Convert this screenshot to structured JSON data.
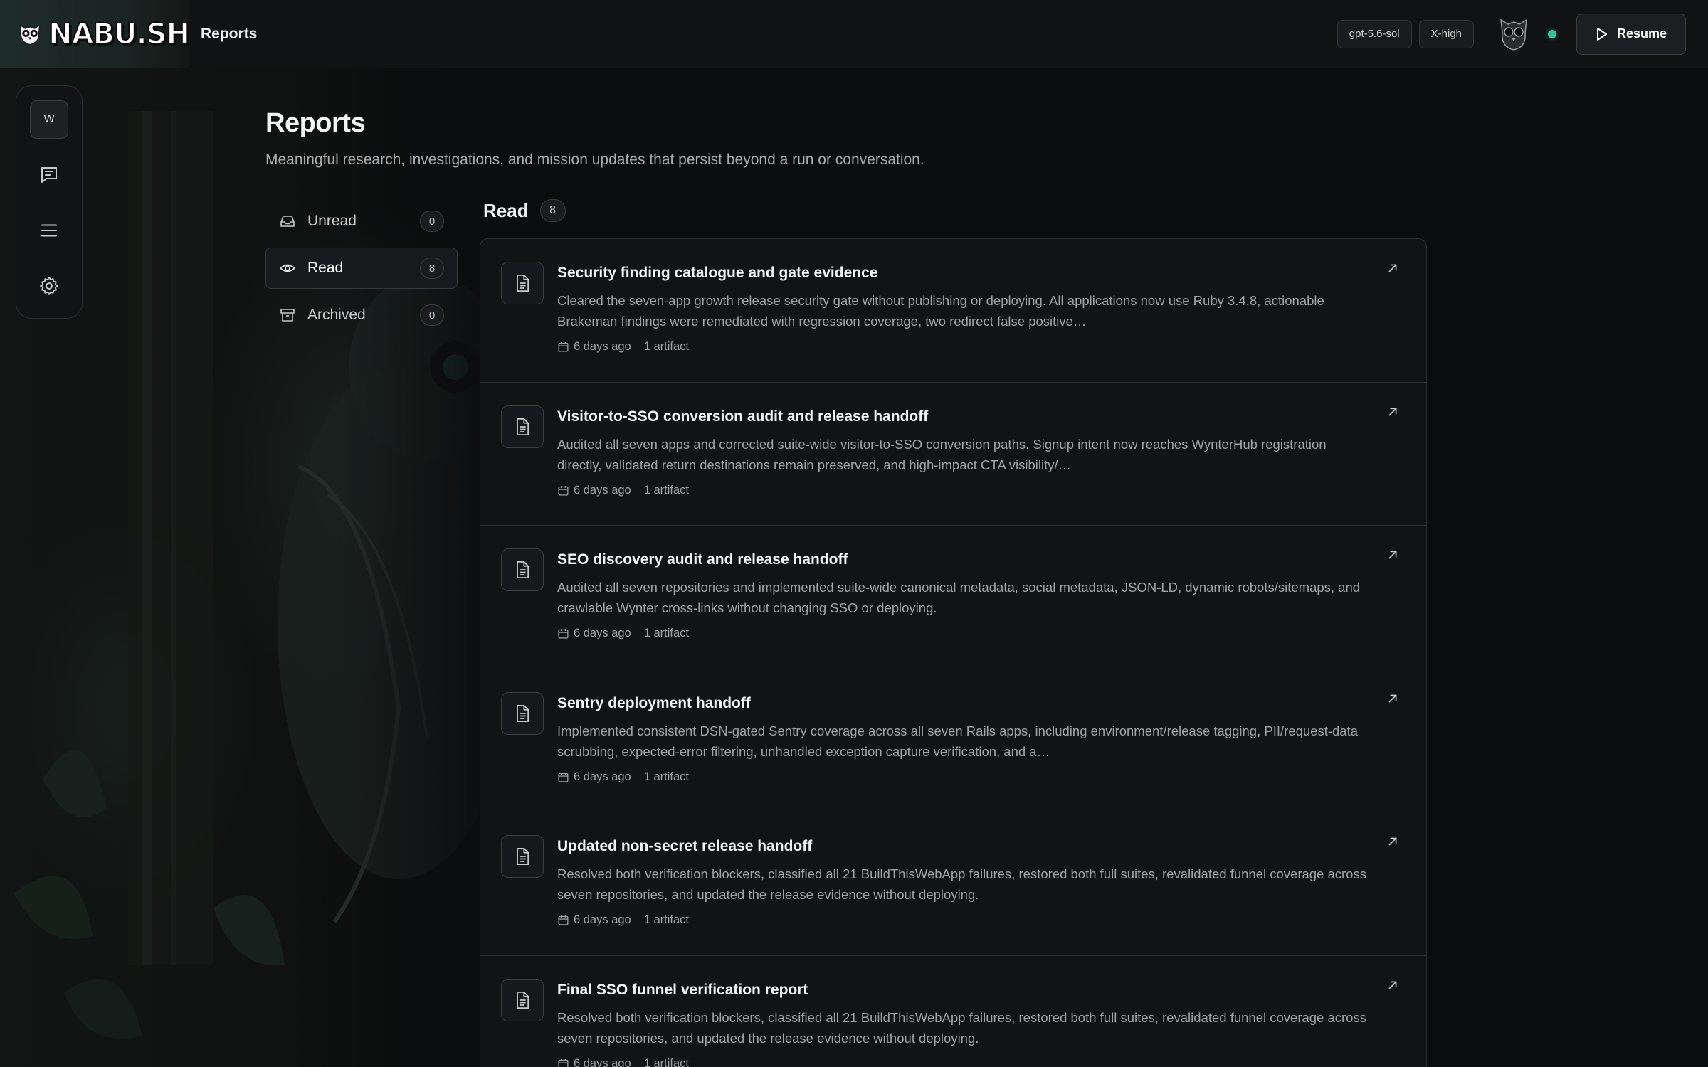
{
  "app": {
    "brand": "NABU.SH",
    "header_title": "Reports",
    "model_chip": "gpt-5.6-sol",
    "effort_chip": "X-high",
    "resume_label": "Resume",
    "status_color": "#34c39a"
  },
  "rail": {
    "workspace_initial": "W",
    "items": [
      "chat-icon",
      "list-icon",
      "gear-icon"
    ]
  },
  "page": {
    "title": "Reports",
    "subtitle": "Meaningful research, investigations, and mission updates that persist beyond a run or conversation."
  },
  "filters": [
    {
      "label": "Unread",
      "count": "0",
      "icon": "inbox-icon",
      "active": false
    },
    {
      "label": "Read",
      "count": "8",
      "icon": "eye-icon",
      "active": true
    },
    {
      "label": "Archived",
      "count": "0",
      "icon": "archive-icon",
      "active": false
    }
  ],
  "section": {
    "title": "Read",
    "count": "8"
  },
  "reports": [
    {
      "title": "Security finding catalogue and gate evidence",
      "description": "Cleared the seven-app growth release security gate without publishing or deploying. All applications now use Ruby 3.4.8, actionable Brakeman findings were remediated with regression coverage, two redirect false positive…",
      "time": "6 days ago",
      "artifacts": "1 artifact"
    },
    {
      "title": "Visitor-to-SSO conversion audit and release handoff",
      "description": "Audited all seven apps and corrected suite-wide visitor-to-SSO conversion paths. Signup intent now reaches WynterHub registration directly, validated return destinations remain preserved, and high-impact CTA visibility/…",
      "time": "6 days ago",
      "artifacts": "1 artifact"
    },
    {
      "title": "SEO discovery audit and release handoff",
      "description": "Audited all seven repositories and implemented suite-wide canonical metadata, social metadata, JSON-LD, dynamic robots/sitemaps, and crawlable Wynter cross-links without changing SSO or deploying.",
      "time": "6 days ago",
      "artifacts": "1 artifact"
    },
    {
      "title": "Sentry deployment handoff",
      "description": "Implemented consistent DSN-gated Sentry coverage across all seven Rails apps, including environment/release tagging, PII/request-data scrubbing, expected-error filtering, unhandled exception capture verification, and a…",
      "time": "6 days ago",
      "artifacts": "1 artifact"
    },
    {
      "title": "Updated non-secret release handoff",
      "description": "Resolved both verification blockers, classified all 21 BuildThisWebApp failures, restored both full suites, revalidated funnel coverage across seven repositories, and updated the release evidence without deploying.",
      "time": "6 days ago",
      "artifacts": "1 artifact"
    },
    {
      "title": "Final SSO funnel verification report",
      "description": "Resolved both verification blockers, classified all 21 BuildThisWebApp failures, restored both full suites, revalidated funnel coverage across seven repositories, and updated the release evidence without deploying.",
      "time": "6 days ago",
      "artifacts": "1 artifact"
    }
  ]
}
